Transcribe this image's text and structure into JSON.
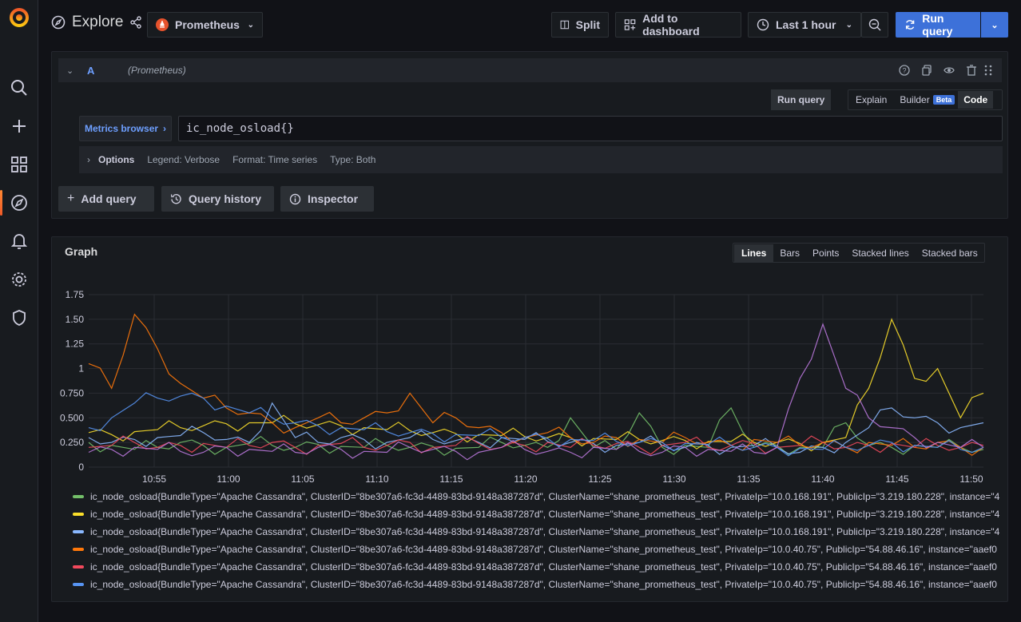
{
  "header": {
    "title": "Explore",
    "datasource": "Prometheus",
    "split_label": "Split",
    "add_dashboard_label": "Add to dashboard",
    "time_range": "Last 1 hour",
    "run_query_label": "Run query"
  },
  "query": {
    "ref_id": "A",
    "datasource_label": "(Prometheus)",
    "run_query_small": "Run query",
    "mode_explain": "Explain",
    "mode_builder": "Builder",
    "builder_badge": "Beta",
    "mode_code": "Code",
    "metrics_browser_label": "Metrics browser",
    "expression": "ic_node_osload{}",
    "options_label": "Options",
    "legend_opt": "Legend: Verbose",
    "format_opt": "Format: Time series",
    "type_opt": "Type: Both"
  },
  "actions": {
    "add_query": "Add query",
    "query_history": "Query history",
    "inspector": "Inspector"
  },
  "graph": {
    "title": "Graph",
    "modes": [
      "Lines",
      "Bars",
      "Points",
      "Stacked lines",
      "Stacked bars"
    ],
    "active_mode": "Lines"
  },
  "chart_data": {
    "type": "line",
    "x_ticks": [
      "10:55",
      "11:00",
      "11:05",
      "11:10",
      "11:15",
      "11:20",
      "11:25",
      "11:30",
      "11:35",
      "11:40",
      "11:45",
      "11:50"
    ],
    "y_ticks": [
      "0",
      "0.250",
      "0.500",
      "0.750",
      "1",
      "1.25",
      "1.50",
      "1.75"
    ],
    "ylim": [
      0,
      1.75
    ],
    "grid": true,
    "legend_placement": "bottom",
    "series": [
      {
        "name": "ic_node_osload{BundleType=\"Apache Cassandra\", ClusterID=\"8be307a6-fc3d-4489-83bd-9148a387287d\", ClusterName=\"shane_prometheus_test\", PrivateIp=\"10.0.168.191\", PublicIp=\"3.219.180.228\", instance=\"4",
        "color": "#73bf69",
        "values": [
          0.25,
          0.22,
          0.18,
          0.2,
          0.25,
          0.22,
          0.2,
          0.24,
          0.22,
          0.2,
          0.23,
          0.21,
          0.2,
          0.22,
          0.2,
          0.21,
          0.19,
          0.2,
          0.25,
          0.22,
          0.2,
          0.5,
          0.2,
          0.18,
          0.55,
          0.2,
          0.22,
          0.2,
          0.6,
          0.2,
          0.22,
          0.2,
          0.2,
          0.45,
          0.22,
          0.2,
          0.22,
          0.2,
          0.2,
          0.18
        ]
      },
      {
        "name": "ic_node_osload{BundleType=\"Apache Cassandra\", ClusterID=\"8be307a6-fc3d-4489-83bd-9148a387287d\", ClusterName=\"shane_prometheus_test\", PrivateIp=\"10.0.168.191\", PublicIp=\"3.219.180.228\", instance=\"4",
        "color": "#fade2a",
        "values": [
          0.35,
          0.33,
          0.36,
          0.38,
          0.4,
          0.42,
          0.44,
          0.45,
          0.45,
          0.44,
          0.43,
          0.42,
          0.4,
          0.38,
          0.37,
          0.35,
          0.34,
          0.33,
          0.32,
          0.31,
          0.3,
          0.3,
          0.29,
          0.28,
          0.28,
          0.27,
          0.27,
          0.26,
          0.26,
          0.25,
          0.25,
          0.24,
          0.25,
          0.3,
          0.8,
          1.5,
          0.9,
          1.0,
          0.5,
          0.75
        ]
      },
      {
        "name": "ic_node_osload{BundleType=\"Apache Cassandra\", ClusterID=\"8be307a6-fc3d-4489-83bd-9148a387287d\", ClusterName=\"shane_prometheus_test\", PrivateIp=\"10.0.168.191\", PublicIp=\"3.219.180.228\", instance=\"4",
        "color": "#8ab8ff",
        "values": [
          0.3,
          0.25,
          0.28,
          0.3,
          0.32,
          0.35,
          0.28,
          0.25,
          0.65,
          0.3,
          0.25,
          0.3,
          0.28,
          0.25,
          0.3,
          0.28,
          0.27,
          0.25,
          0.3,
          0.28,
          0.26,
          0.25,
          0.24,
          0.22,
          0.25,
          0.22,
          0.2,
          0.22,
          0.2,
          0.22,
          0.2,
          0.15,
          0.2,
          0.25,
          0.4,
          0.6,
          0.5,
          0.45,
          0.4,
          0.45
        ]
      },
      {
        "name": "ic_node_osload{BundleType=\"Apache Cassandra\", ClusterID=\"8be307a6-fc3d-4489-83bd-9148a387287d\", ClusterName=\"shane_prometheus_test\", PrivateIp=\"10.0.40.75\", PublicIp=\"54.88.46.16\", instance=\"aaef0",
        "color": "#ff780a",
        "values": [
          1.05,
          0.8,
          1.55,
          1.2,
          0.85,
          0.7,
          0.6,
          0.55,
          0.45,
          0.4,
          0.5,
          0.45,
          0.5,
          0.55,
          0.75,
          0.45,
          0.5,
          0.4,
          0.35,
          0.3,
          0.35,
          0.3,
          0.25,
          0.3,
          0.28,
          0.25,
          0.3,
          0.25,
          0.22,
          0.28,
          0.25,
          0.22,
          0.25,
          0.2,
          0.25,
          0.22,
          0.2,
          0.25,
          0.2,
          0.2
        ]
      },
      {
        "name": "ic_node_osload{BundleType=\"Apache Cassandra\", ClusterID=\"8be307a6-fc3d-4489-83bd-9148a387287d\", ClusterName=\"shane_prometheus_test\", PrivateIp=\"10.0.40.75\", PublicIp=\"54.88.46.16\", instance=\"aaef0",
        "color": "#f2495c",
        "values": [
          0.2,
          0.22,
          0.25,
          0.2,
          0.22,
          0.24,
          0.2,
          0.22,
          0.25,
          0.2,
          0.22,
          0.24,
          0.2,
          0.22,
          0.25,
          0.2,
          0.22,
          0.24,
          0.2,
          0.22,
          0.25,
          0.2,
          0.22,
          0.24,
          0.2,
          0.22,
          0.25,
          0.2,
          0.22,
          0.24,
          0.2,
          0.22,
          0.25,
          0.2,
          0.22,
          0.24,
          0.2,
          0.22,
          0.2,
          0.22
        ]
      },
      {
        "name": "ic_node_osload{BundleType=\"Apache Cassandra\", ClusterID=\"8be307a6-fc3d-4489-83bd-9148a387287d\", ClusterName=\"shane_prometheus_test\", PrivateIp=\"10.0.40.75\", PublicIp=\"54.88.46.16\", instance=\"aaef0",
        "color": "#5794f2",
        "values": [
          0.4,
          0.5,
          0.65,
          0.7,
          0.72,
          0.7,
          0.62,
          0.55,
          0.5,
          0.45,
          0.42,
          0.4,
          0.38,
          0.36,
          0.35,
          0.34,
          0.33,
          0.32,
          0.3,
          0.3,
          0.29,
          0.28,
          0.27,
          0.26,
          0.25,
          0.25,
          0.24,
          0.23,
          0.22,
          0.2,
          0.2,
          0.19,
          0.18,
          0.2,
          0.22,
          0.25,
          0.22,
          0.2,
          0.18,
          0.2
        ]
      },
      {
        "name": "",
        "color": "#b877d9",
        "values": [
          0.15,
          0.18,
          0.2,
          0.18,
          0.16,
          0.15,
          0.2,
          0.18,
          0.16,
          0.15,
          0.2,
          0.18,
          0.16,
          0.15,
          0.2,
          0.18,
          0.16,
          0.15,
          0.2,
          0.18,
          0.16,
          0.15,
          0.2,
          0.18,
          0.16,
          0.15,
          0.2,
          0.18,
          0.16,
          0.15,
          0.2,
          0.9,
          1.45,
          0.8,
          0.5,
          0.4,
          0.3,
          0.25,
          0.2,
          0.2
        ]
      }
    ]
  }
}
